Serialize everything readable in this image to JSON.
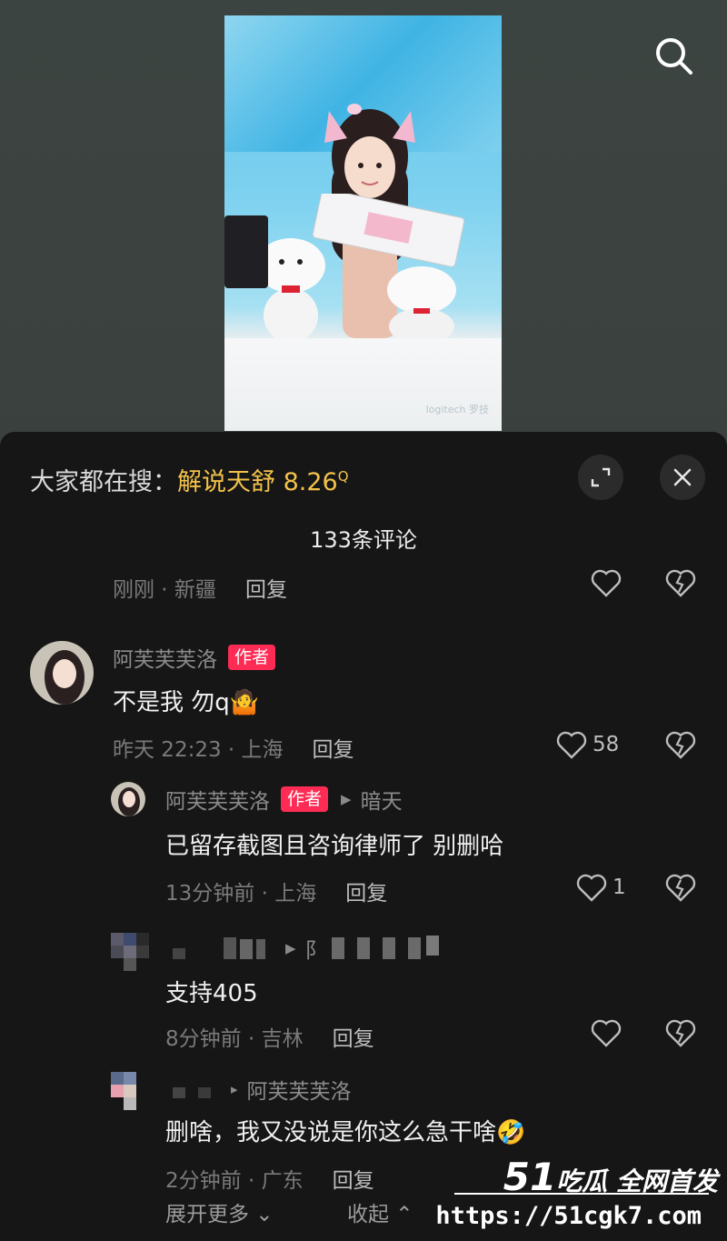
{
  "header": {
    "search_icon": "search-icon"
  },
  "hot_search": {
    "prefix": "大家都在搜：",
    "keyword": "解说天舒 8.26",
    "suffix_icon": "Q"
  },
  "panel": {
    "comment_count": "133条评论",
    "expand_icon": "expand-icon",
    "close_icon": "close-icon"
  },
  "comments": [
    {
      "meta_time": "刚刚 · 新疆",
      "reply": "回复"
    },
    {
      "username": "阿芙芙芙洛",
      "tag": "作者",
      "text": "不是我 勿q🤷",
      "meta_time": "昨天 22:23 · 上海",
      "reply": "回复",
      "likes": "58"
    },
    {
      "username": "阿芙芙芙洛",
      "tag": "作者",
      "reply_to": "暗天",
      "text": "已留存截图且咨询律师了 别删哈",
      "meta_time": "13分钟前 · 上海",
      "reply": "回复",
      "likes": "1"
    },
    {
      "reply_to_partial": "阝",
      "text": "支持405",
      "meta_time": "8分钟前 · 吉林",
      "reply": "回复"
    },
    {
      "reply_to": "阿芙芙芙洛",
      "text": "删啥，我又没说是你这么急干啥🤣",
      "meta_time": "2分钟前 · 广东",
      "reply": "回复"
    }
  ],
  "footer": {
    "expand_more": "展开更多",
    "collapse": "收起"
  },
  "site_watermark": {
    "brand_num": "51",
    "brand_text": "吃瓜 全网首发",
    "url": "https://51cgk7.com"
  },
  "video": {
    "watermark": "logitech 罗技"
  }
}
